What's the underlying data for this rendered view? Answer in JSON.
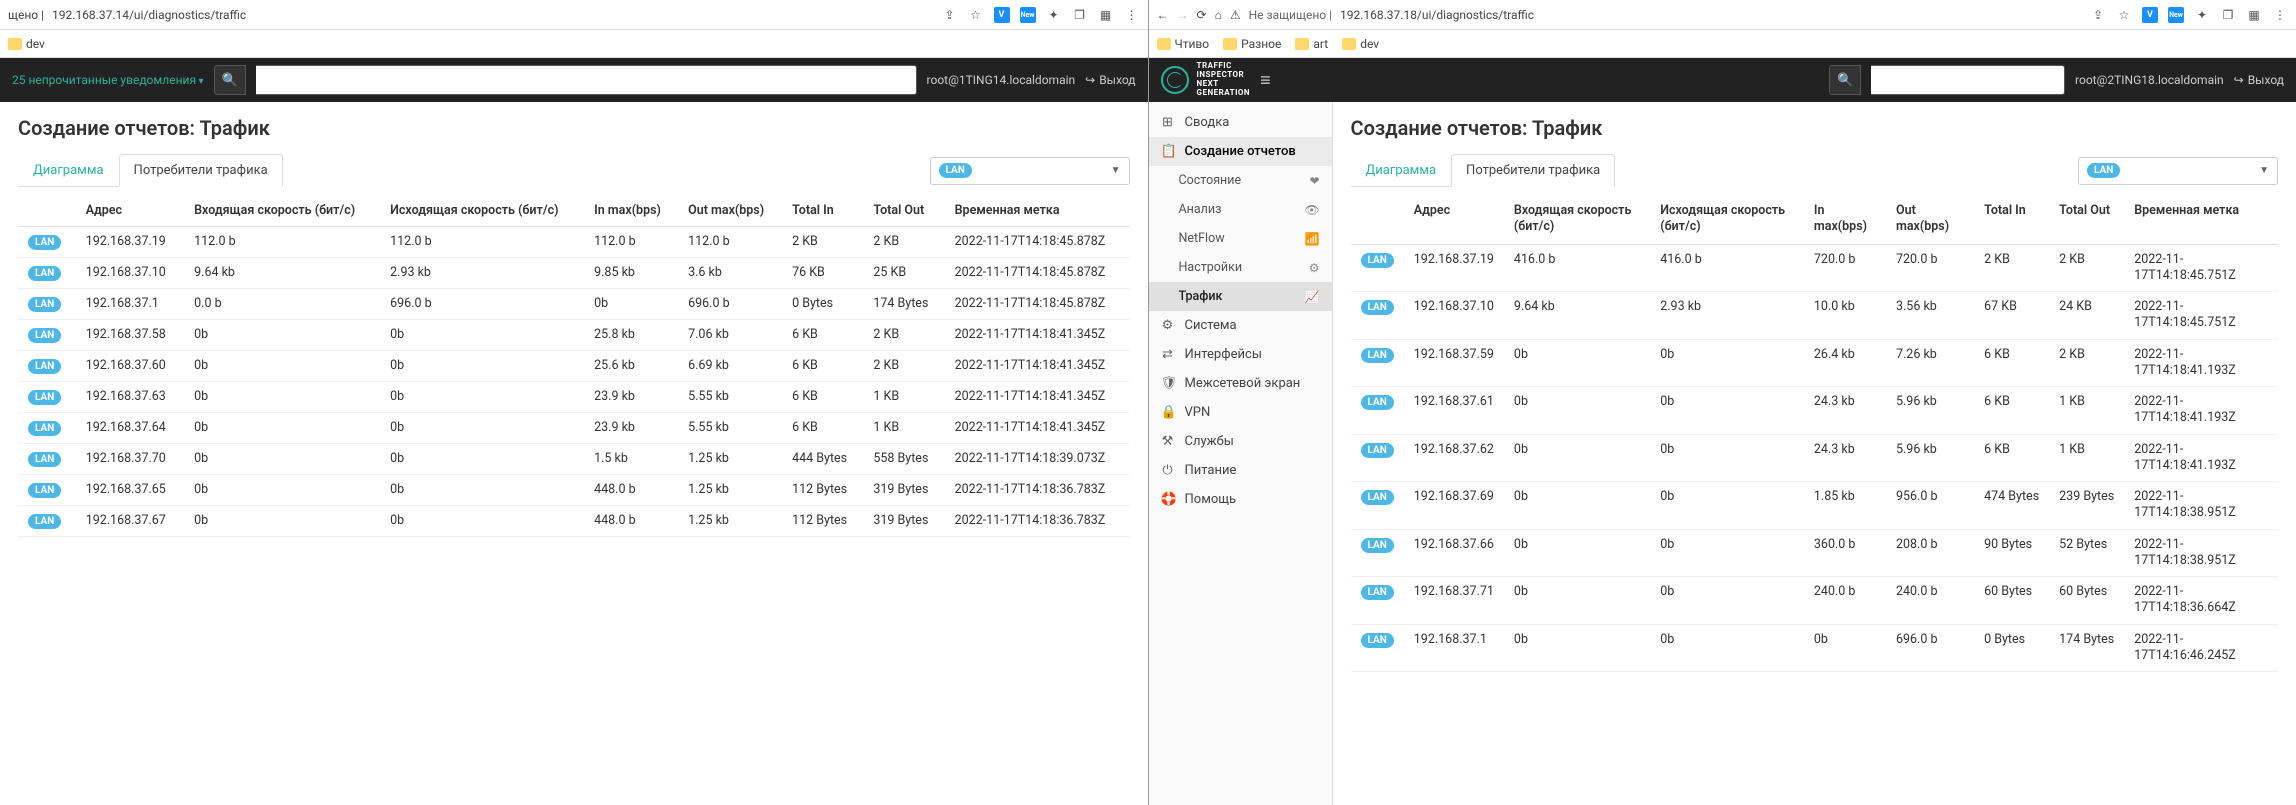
{
  "left": {
    "url_prefix": "щено |",
    "url": "192.168.37.14/ui/diagnostics/traffic",
    "bookmarks": [
      "dev"
    ],
    "unread": "25 непрочитанные уведомления",
    "user": "root@1TING14.localdomain",
    "exit": "Выход",
    "page_title": "Создание отчетов: Трафик",
    "tabs": {
      "diagram": "Диаграмма",
      "consumers": "Потребители трафика"
    },
    "iface": "LAN",
    "columns": [
      "",
      "Адрес",
      "Входящая скорость (бит/с)",
      "Исходящая скорость (бит/с)",
      "In max(bps)",
      "Out max(bps)",
      "Total In",
      "Total Out",
      "Временная метка"
    ],
    "rows": [
      [
        "LAN",
        "192.168.37.19",
        "112.0 b",
        "112.0 b",
        "112.0 b",
        "112.0 b",
        "2 KB",
        "2 KB",
        "2022-11-17T14:18:45.878Z"
      ],
      [
        "LAN",
        "192.168.37.10",
        "9.64 kb",
        "2.93 kb",
        "9.85 kb",
        "3.6 kb",
        "76 KB",
        "25 KB",
        "2022-11-17T14:18:45.878Z"
      ],
      [
        "LAN",
        "192.168.37.1",
        "0.0 b",
        "696.0 b",
        "0b",
        "696.0 b",
        "0 Bytes",
        "174 Bytes",
        "2022-11-17T14:18:45.878Z"
      ],
      [
        "LAN",
        "192.168.37.58",
        "0b",
        "0b",
        "25.8 kb",
        "7.06 kb",
        "6 KB",
        "2 KB",
        "2022-11-17T14:18:41.345Z"
      ],
      [
        "LAN",
        "192.168.37.60",
        "0b",
        "0b",
        "25.6 kb",
        "6.69 kb",
        "6 KB",
        "2 KB",
        "2022-11-17T14:18:41.345Z"
      ],
      [
        "LAN",
        "192.168.37.63",
        "0b",
        "0b",
        "23.9 kb",
        "5.55 kb",
        "6 KB",
        "1 KB",
        "2022-11-17T14:18:41.345Z"
      ],
      [
        "LAN",
        "192.168.37.64",
        "0b",
        "0b",
        "23.9 kb",
        "5.55 kb",
        "6 KB",
        "1 KB",
        "2022-11-17T14:18:41.345Z"
      ],
      [
        "LAN",
        "192.168.37.70",
        "0b",
        "0b",
        "1.5 kb",
        "1.25 kb",
        "444 Bytes",
        "558 Bytes",
        "2022-11-17T14:18:39.073Z"
      ],
      [
        "LAN",
        "192.168.37.65",
        "0b",
        "0b",
        "448.0 b",
        "1.25 kb",
        "112 Bytes",
        "319 Bytes",
        "2022-11-17T14:18:36.783Z"
      ],
      [
        "LAN",
        "192.168.37.67",
        "0b",
        "0b",
        "448.0 b",
        "1.25 kb",
        "112 Bytes",
        "319 Bytes",
        "2022-11-17T14:18:36.783Z"
      ]
    ]
  },
  "right": {
    "insecure": "Не защищено |",
    "url": "192.168.37.18/ui/diagnostics/traffic",
    "bookmarks": [
      "Чтиво",
      "Разное",
      "art",
      "dev"
    ],
    "logo_text": "TRAFFIC\nINSPECTOR\nNEXT\nGENERATION",
    "user": "root@2TING18.localdomain",
    "exit": "Выход",
    "sidebar": [
      {
        "label": "Сводка",
        "icon": "⊞",
        "type": "top"
      },
      {
        "label": "Создание отчетов",
        "icon": "📋",
        "type": "top",
        "active": true
      },
      {
        "label": "Состояние",
        "type": "sub",
        "ricon": "❤"
      },
      {
        "label": "Анализ",
        "type": "sub",
        "ricon": "👁"
      },
      {
        "label": "NetFlow",
        "type": "sub",
        "ricon": "📶"
      },
      {
        "label": "Настройки",
        "type": "sub",
        "ricon": "⚙"
      },
      {
        "label": "Трафик",
        "type": "sub",
        "ricon": "📈",
        "active": true
      },
      {
        "label": "Система",
        "icon": "⚙",
        "type": "top"
      },
      {
        "label": "Интерфейсы",
        "icon": "⇄",
        "type": "top"
      },
      {
        "label": "Межсетевой экран",
        "icon": "🛡",
        "type": "top"
      },
      {
        "label": "VPN",
        "icon": "🔒",
        "type": "top"
      },
      {
        "label": "Службы",
        "icon": "⚒",
        "type": "top"
      },
      {
        "label": "Питание",
        "icon": "⏻",
        "type": "top"
      },
      {
        "label": "Помощь",
        "icon": "🛟",
        "type": "top"
      }
    ],
    "page_title": "Создание отчетов: Трафик",
    "tabs": {
      "diagram": "Диаграмма",
      "consumers": "Потребители трафика"
    },
    "iface": "LAN",
    "columns": [
      "",
      "Адрес",
      "Входящая скорость (бит/с)",
      "Исходящая скорость (бит/с)",
      "In max(bps)",
      "Out max(bps)",
      "Total In",
      "Total Out",
      "Временная метка"
    ],
    "rows": [
      [
        "LAN",
        "192.168.37.19",
        "416.0 b",
        "416.0 b",
        "720.0 b",
        "720.0 b",
        "2 KB",
        "2 KB",
        "2022-11-17T14:18:45.751Z"
      ],
      [
        "LAN",
        "192.168.37.10",
        "9.64 kb",
        "2.93 kb",
        "10.0 kb",
        "3.56 kb",
        "67 KB",
        "24 KB",
        "2022-11-17T14:18:45.751Z"
      ],
      [
        "LAN",
        "192.168.37.59",
        "0b",
        "0b",
        "26.4 kb",
        "7.26 kb",
        "6 KB",
        "2 KB",
        "2022-11-17T14:18:41.193Z"
      ],
      [
        "LAN",
        "192.168.37.61",
        "0b",
        "0b",
        "24.3 kb",
        "5.96 kb",
        "6 KB",
        "1 KB",
        "2022-11-17T14:18:41.193Z"
      ],
      [
        "LAN",
        "192.168.37.62",
        "0b",
        "0b",
        "24.3 kb",
        "5.96 kb",
        "6 KB",
        "1 KB",
        "2022-11-17T14:18:41.193Z"
      ],
      [
        "LAN",
        "192.168.37.69",
        "0b",
        "0b",
        "1.85 kb",
        "956.0 b",
        "474 Bytes",
        "239 Bytes",
        "2022-11-17T14:18:38.951Z"
      ],
      [
        "LAN",
        "192.168.37.66",
        "0b",
        "0b",
        "360.0 b",
        "208.0 b",
        "90 Bytes",
        "52 Bytes",
        "2022-11-17T14:18:38.951Z"
      ],
      [
        "LAN",
        "192.168.37.71",
        "0b",
        "0b",
        "240.0 b",
        "240.0 b",
        "60 Bytes",
        "60 Bytes",
        "2022-11-17T14:18:36.664Z"
      ],
      [
        "LAN",
        "192.168.37.1",
        "0b",
        "0b",
        "0b",
        "696.0 b",
        "0 Bytes",
        "174 Bytes",
        "2022-11-17T14:16:46.245Z"
      ]
    ]
  }
}
